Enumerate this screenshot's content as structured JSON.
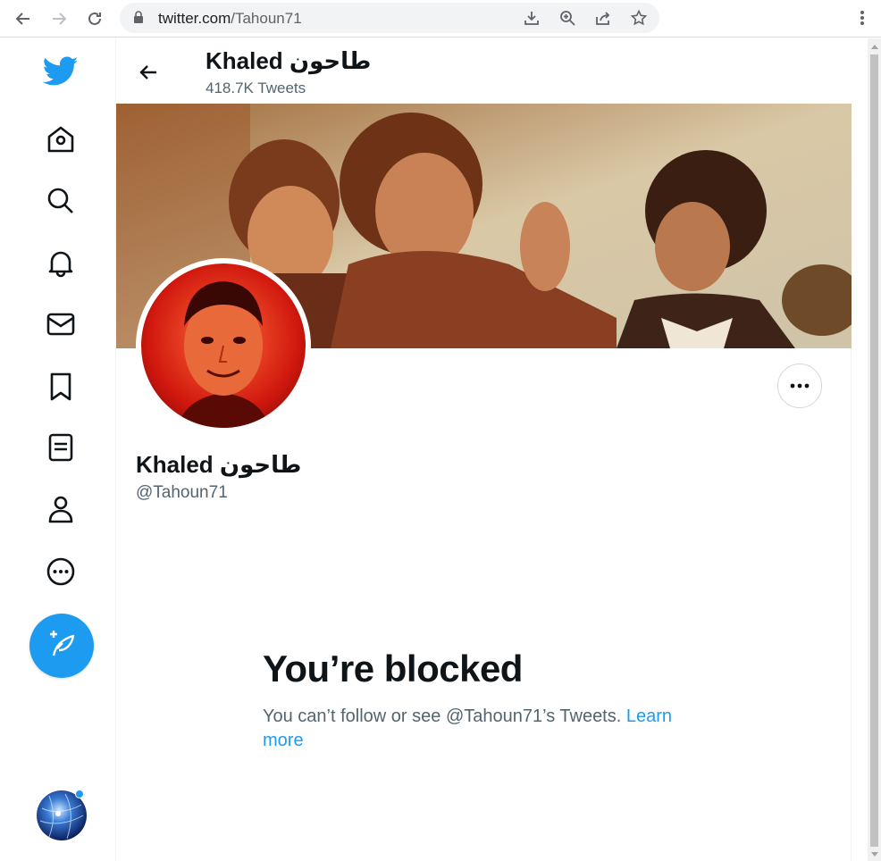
{
  "browser": {
    "url_host": "twitter.com",
    "url_path": "/Tahoun71",
    "icons": [
      "back-arrow-icon",
      "forward-arrow-icon",
      "reload-icon",
      "lock-icon",
      "download-icon",
      "zoom-icon",
      "share-icon",
      "star-icon",
      "kebab-menu-icon"
    ]
  },
  "sidebar": {
    "items": [
      "twitter-logo",
      "home",
      "explore",
      "notifications",
      "messages",
      "bookmarks",
      "lists",
      "profile",
      "more"
    ],
    "compose_icon": "feather-plus-icon"
  },
  "header": {
    "title": "طاحون Khaled",
    "subtitle": "418.7K Tweets"
  },
  "profile": {
    "name": "طاحون Khaled",
    "handle": "@Tahoun71"
  },
  "blocked": {
    "title": "You’re blocked",
    "message": "You can’t follow or see @Tahoun71’s Tweets. ",
    "link": "Learn more"
  },
  "colors": {
    "accent": "#1d9bf0",
    "text": "#0f1419",
    "secondary": "#536471"
  }
}
